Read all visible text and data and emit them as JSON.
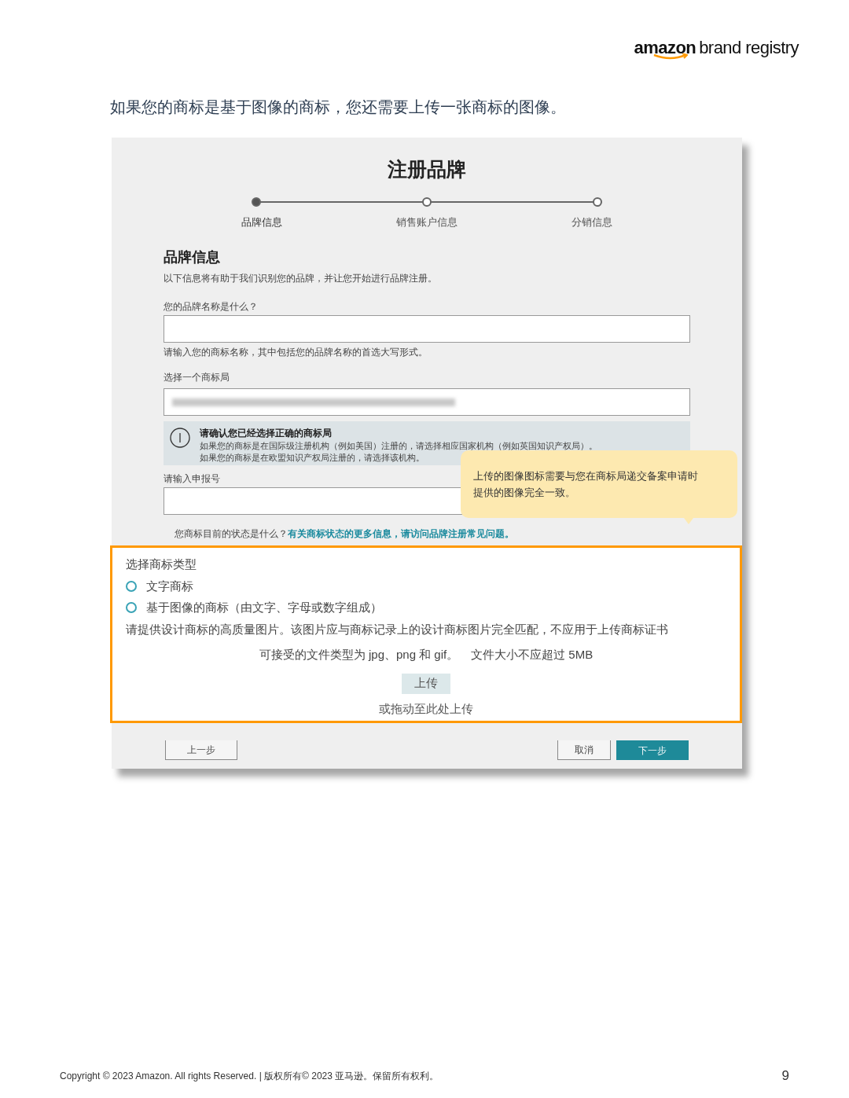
{
  "header": {
    "logo_word": "amazon",
    "logo_tail": "brand registry"
  },
  "intro": "如果您的商标是基于图像的商标，您还需要上传一张商标的图像。",
  "screenshot": {
    "title": "注册品牌",
    "steps": [
      {
        "label": "品牌信息",
        "selected": true
      },
      {
        "label": "销售账户信息",
        "selected": false
      },
      {
        "label": "分销信息",
        "selected": false
      }
    ],
    "section_title": "品牌信息",
    "section_desc": "以下信息将有助于我们识别您的品牌，并让您开始进行品牌注册。",
    "brand_name": {
      "label": "您的品牌名称是什么？",
      "hint": "请输入您的商标名称，其中包括您的品牌名称的首选大写形式。"
    },
    "office": {
      "label": "选择一个商标局"
    },
    "notice": {
      "title": "请确认您已经选择正确的商标局",
      "lines": [
        "如果您的商标是在国际级注册机构（例如美国）注册的，请选择相应国家机构（例如英国知识产权局）。",
        "如果您的商标是在欧盟知识产权局注册的，请选择该机构。"
      ]
    },
    "application": {
      "label": "请输入申报号"
    },
    "status_question": "您商标目前的状态是什么？",
    "status_link": "有关商标状态的更多信息，请访问品牌注册常见问题。",
    "tooltip": "上传的图像图标需要与您在商标局递交备案申请时提供的图像完全一致。",
    "type_section": {
      "label": "选择商标类型",
      "options": [
        {
          "label": "文字商标",
          "selected": false
        },
        {
          "label": "基于图像的商标（由文字、字母或数字组成）",
          "selected": false
        }
      ],
      "instructions": "请提供设计商标的高质量图片。该图片应与商标记录上的设计商标图片完全匹配，不应用于上传商标证书",
      "file_types": "可接受的文件类型为 jpg、png 和 gif。",
      "file_size": "文件大小不应超过 5MB",
      "upload": "上传",
      "drag": "或拖动至此处上传"
    },
    "buttons": {
      "back": "上一步",
      "cancel": "取消",
      "next": "下一步"
    }
  },
  "footer": {
    "copyright": "Copyright © 2023 Amazon. All rights Reserved. | 版权所有© 2023 亚马逊。保留所有权利。",
    "page": "9"
  }
}
